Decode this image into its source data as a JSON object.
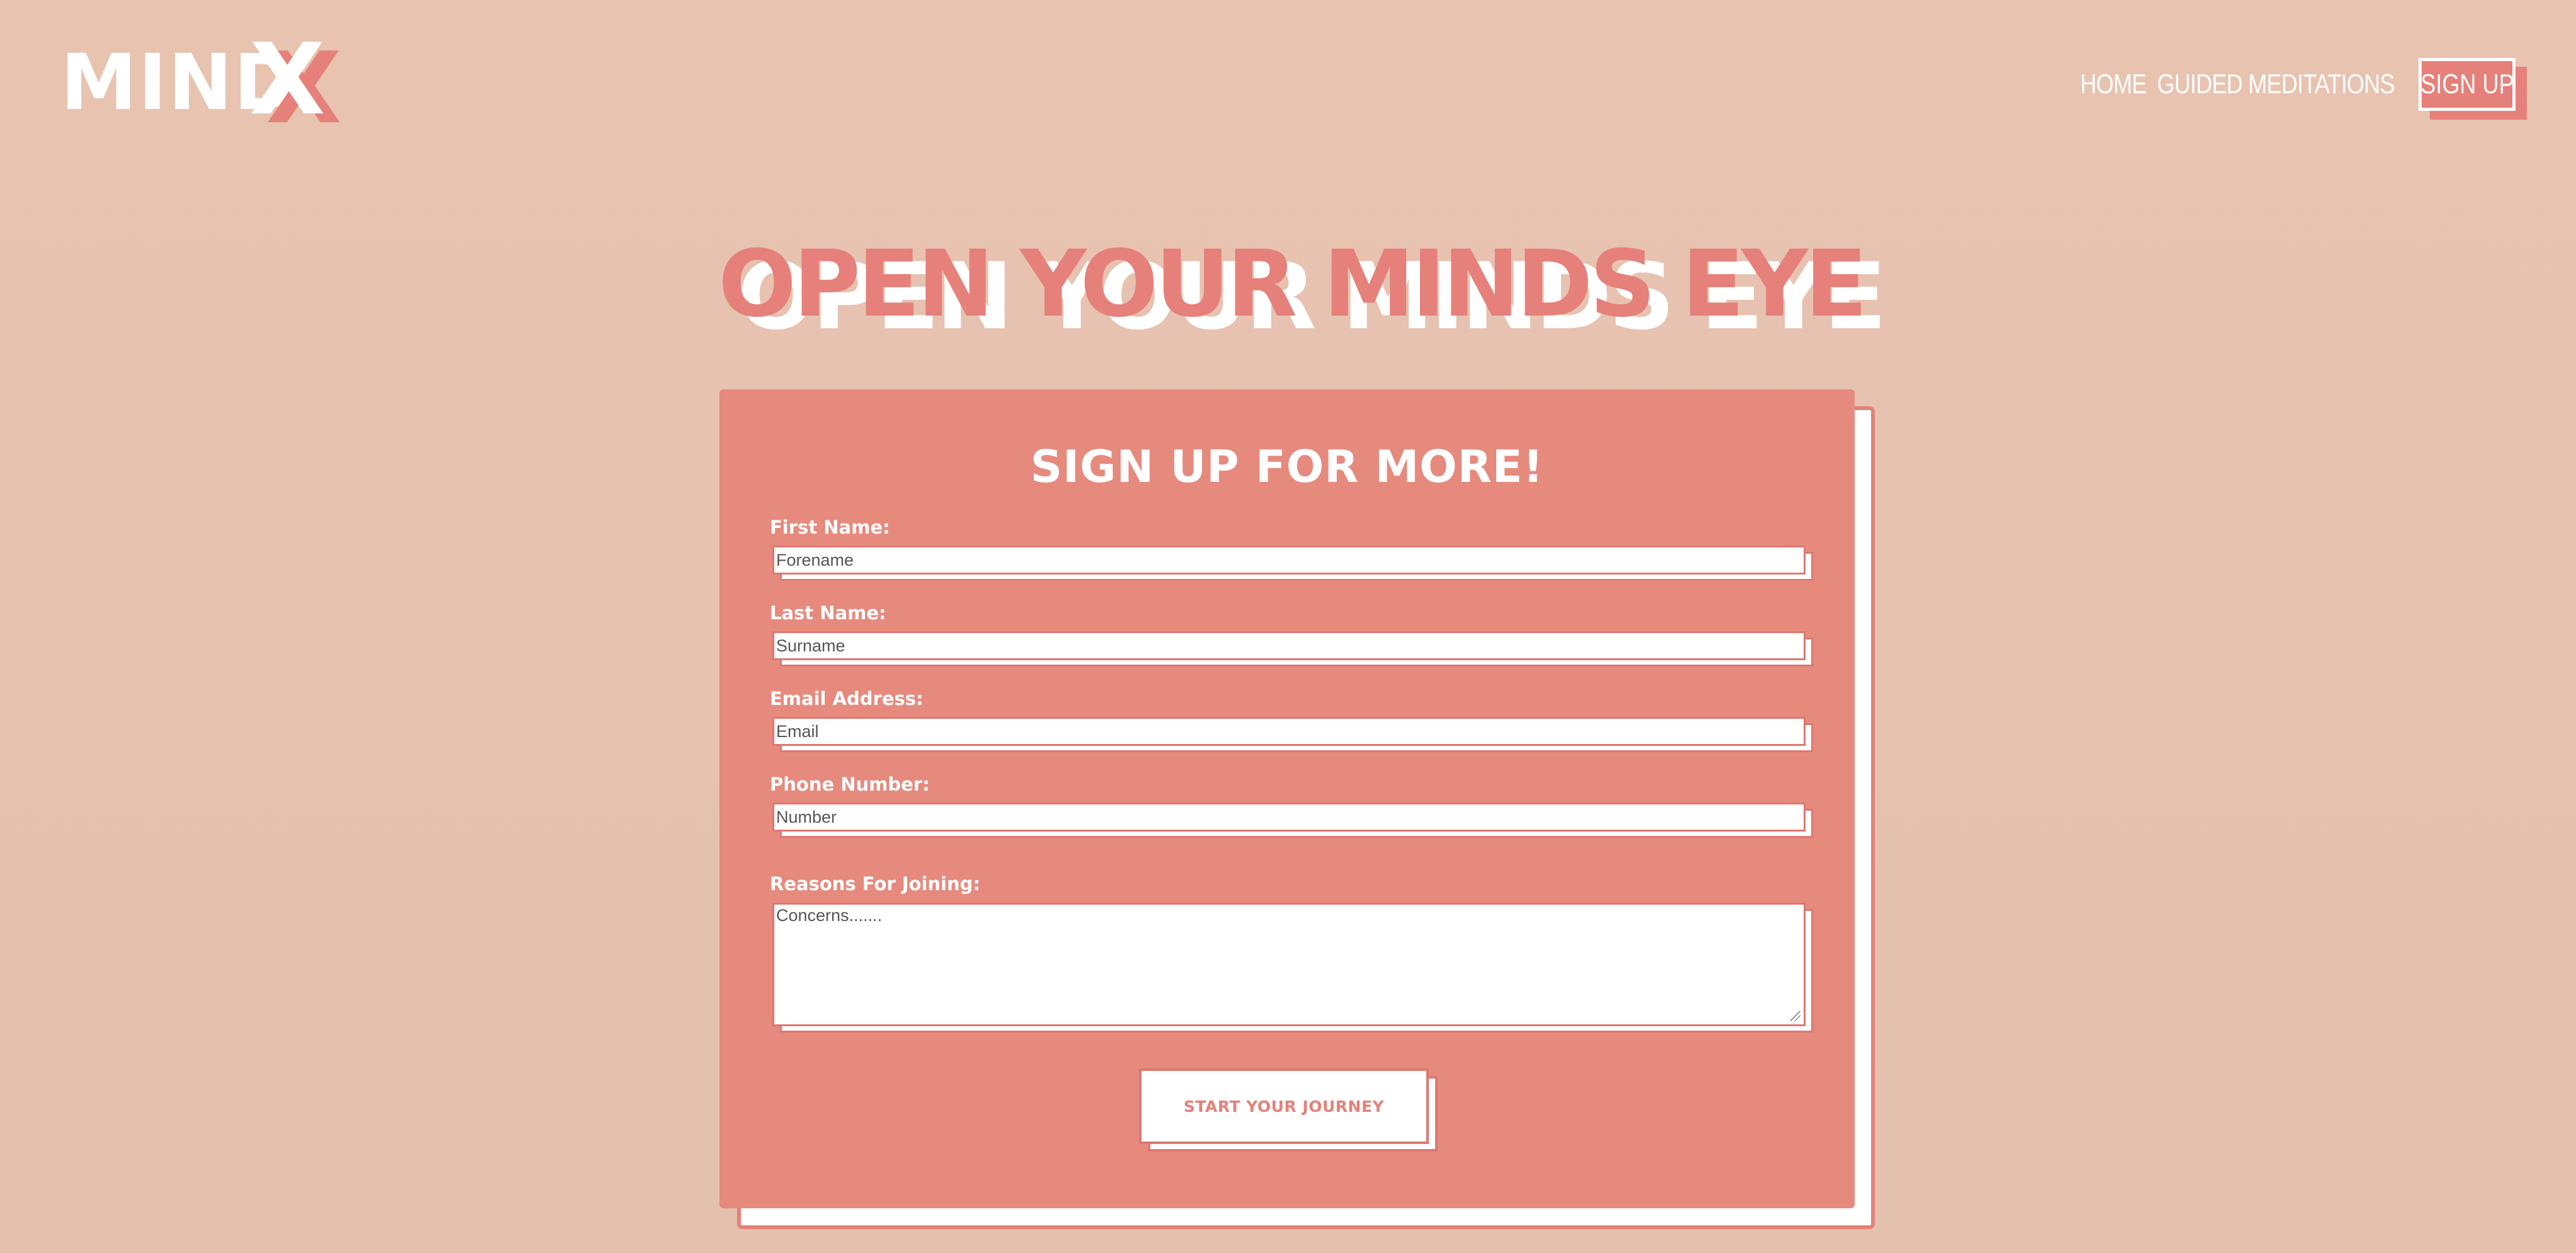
{
  "brand": {
    "logo_main": "MIND",
    "logo_accent": "X"
  },
  "nav": {
    "home": "HOME",
    "guided": "GUIDED MEDITATIONS",
    "signup": "SIGN UP"
  },
  "hero": {
    "title": "OPEN YOUR MINDS EYE"
  },
  "form": {
    "title": "SIGN UP FOR MORE!",
    "first_name": {
      "label": "First Name:",
      "placeholder": "Forename",
      "value": ""
    },
    "last_name": {
      "label": "Last Name:",
      "placeholder": "Surname",
      "value": ""
    },
    "email": {
      "label": "Email Address:",
      "placeholder": "Email",
      "value": ""
    },
    "phone": {
      "label": "Phone Number:",
      "placeholder": "Number",
      "value": ""
    },
    "reasons": {
      "label": "Reasons For Joining:",
      "placeholder": "Concerns.......",
      "value": ""
    },
    "submit": "START YOUR JOURNEY"
  },
  "colors": {
    "background": "#e8c3b0",
    "accent": "#e6807a",
    "card": "#e68a7e",
    "white": "#ffffff"
  }
}
